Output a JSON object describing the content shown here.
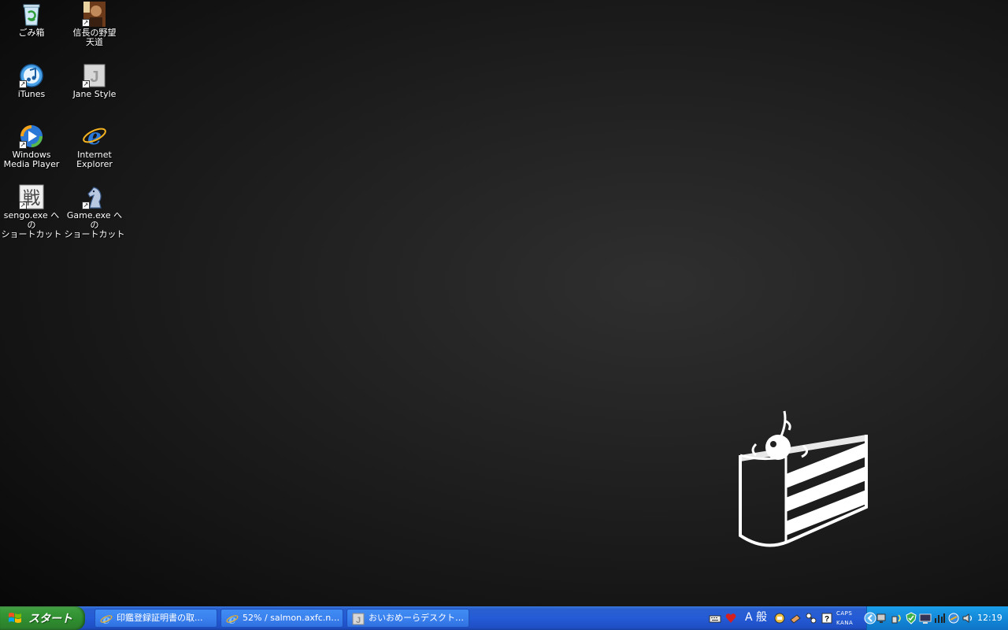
{
  "desktop": {
    "icons": [
      {
        "label": "ごみ箱"
      },
      {
        "label": "信長の野望\n天道"
      },
      {
        "label": "iTunes"
      },
      {
        "label": "Jane Style"
      },
      {
        "label": "Windows\nMedia Player"
      },
      {
        "label": "Internet\nExplorer"
      },
      {
        "label": "sengo.exe への\nショートカット"
      },
      {
        "label": "Game.exe への\nショートカット"
      }
    ]
  },
  "taskbar": {
    "start_label": "スタート",
    "tasks": [
      {
        "label": "印鑑登録証明書の取..."
      },
      {
        "label": "52% / salmon.axfc.net..."
      },
      {
        "label": "おいおめーらデスクトップ..."
      }
    ],
    "ime": {
      "mode": "A 般"
    },
    "caps": "CAPS",
    "kana": "KANA",
    "clock": "12:19"
  },
  "colors": {
    "taskbar_blue": "#245bd6",
    "start_green": "#3a9b3a",
    "tray_blue": "#1489d9"
  }
}
